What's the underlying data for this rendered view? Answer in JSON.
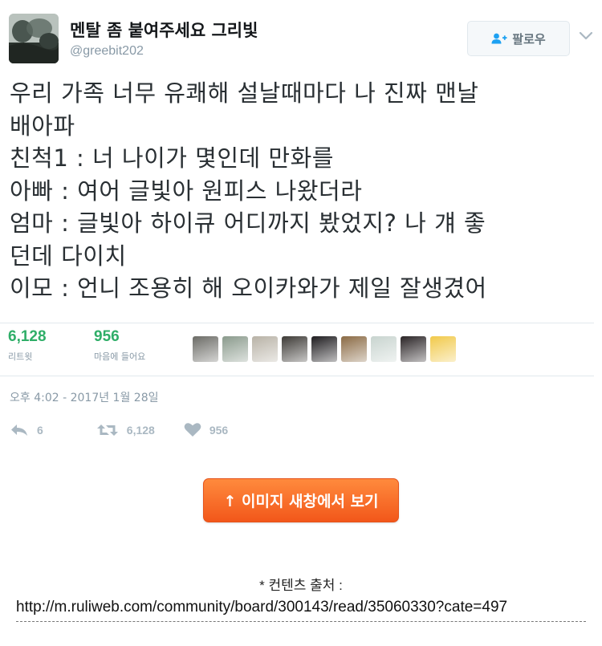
{
  "tweet": {
    "author": {
      "display_name": "멘탈 좀 붙여주세요 그리빛",
      "handle": "@greebit202"
    },
    "follow_button": {
      "label": "팔로우"
    },
    "text_lines": [
      "우리 가족 너무 유쾌해 설날때마다 나 진짜 맨날",
      "배아파",
      "친척1 : 너 나이가 몇인데 만화를",
      "아빠 : 여어 글빛아 원피스 나왔더라",
      "엄마 : 글빛아 하이큐 어디까지 봤었지? 나 걔 좋",
      "던데 다이치",
      "이모 : 언니 조용히 해 오이카와가 제일 잘생겼어"
    ],
    "stats": {
      "retweets": {
        "count": "6,128",
        "label": "리트윗"
      },
      "likes": {
        "count": "956",
        "label": "마음에 들어요"
      }
    },
    "likers": [
      {
        "icon": "liker-avatar-1",
        "color": "#6b6b66"
      },
      {
        "icon": "liker-avatar-2",
        "color": "#8a9a8c"
      },
      {
        "icon": "liker-avatar-3",
        "color": "#b8b2a6"
      },
      {
        "icon": "liker-avatar-4",
        "color": "#3d3a36"
      },
      {
        "icon": "liker-avatar-5",
        "color": "#1e1c1f"
      },
      {
        "icon": "liker-avatar-6",
        "color": "#8a6a44"
      },
      {
        "icon": "liker-avatar-7",
        "color": "#c8d4cf"
      },
      {
        "icon": "liker-avatar-8",
        "color": "#2a2426"
      },
      {
        "icon": "liker-avatar-9",
        "color": "#f1c94a"
      }
    ],
    "timestamp": "오후 4:02 - 2017년 1월 28일",
    "actions": {
      "reply": {
        "icon": "reply-icon",
        "count": "6"
      },
      "retweet": {
        "icon": "retweet-icon",
        "count": "6,128"
      },
      "like": {
        "icon": "heart-icon",
        "count": "956"
      }
    }
  },
  "view_image_button": {
    "label": "↑ 이미지 새창에서 보기"
  },
  "source": {
    "label": "* 컨텐츠 출처 :",
    "url": "http://m.ruliweb.com/community/board/300143/read/35060330?cate=497"
  },
  "colors": {
    "stat_green": "#2fae68",
    "muted_gray": "#8899a6",
    "button_orange": "#f2571a"
  }
}
